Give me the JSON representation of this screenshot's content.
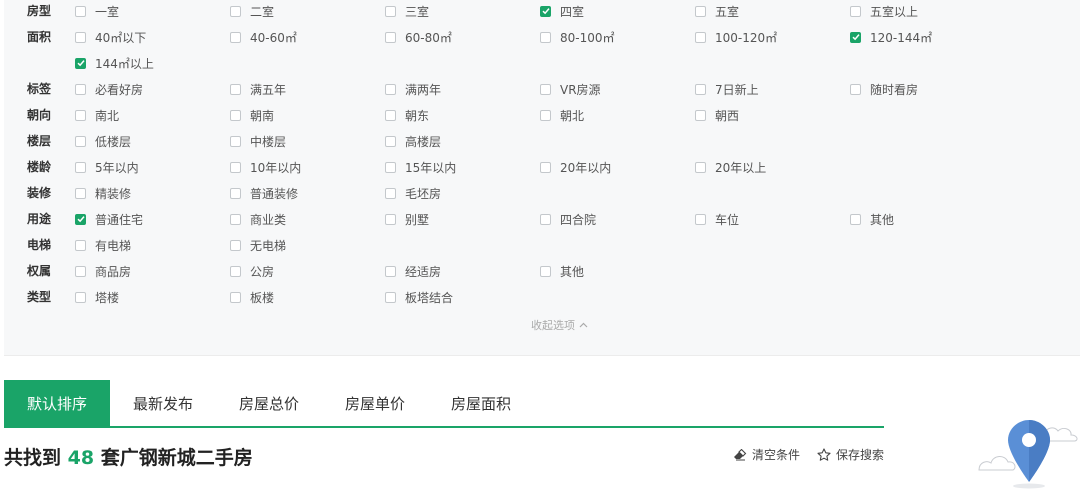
{
  "filters": [
    {
      "label": "房型",
      "options": [
        {
          "text": "一室",
          "checked": false
        },
        {
          "text": "二室",
          "checked": false
        },
        {
          "text": "三室",
          "checked": false
        },
        {
          "text": "四室",
          "checked": true
        },
        {
          "text": "五室",
          "checked": false
        },
        {
          "text": "五室以上",
          "checked": false
        }
      ]
    },
    {
      "label": "面积",
      "options": [
        {
          "text": "40㎡以下",
          "checked": false
        },
        {
          "text": "40-60㎡",
          "checked": false
        },
        {
          "text": "60-80㎡",
          "checked": false
        },
        {
          "text": "80-100㎡",
          "checked": false
        },
        {
          "text": "100-120㎡",
          "checked": false
        },
        {
          "text": "120-144㎡",
          "checked": true
        },
        {
          "text": "144㎡以上",
          "checked": true
        }
      ]
    },
    {
      "label": "标签",
      "options": [
        {
          "text": "必看好房",
          "checked": false
        },
        {
          "text": "满五年",
          "checked": false
        },
        {
          "text": "满两年",
          "checked": false
        },
        {
          "text": "VR房源",
          "checked": false
        },
        {
          "text": "7日新上",
          "checked": false
        },
        {
          "text": "随时看房",
          "checked": false
        }
      ]
    },
    {
      "label": "朝向",
      "options": [
        {
          "text": "南北",
          "checked": false
        },
        {
          "text": "朝南",
          "checked": false
        },
        {
          "text": "朝东",
          "checked": false
        },
        {
          "text": "朝北",
          "checked": false
        },
        {
          "text": "朝西",
          "checked": false
        }
      ]
    },
    {
      "label": "楼层",
      "options": [
        {
          "text": "低楼层",
          "checked": false
        },
        {
          "text": "中楼层",
          "checked": false
        },
        {
          "text": "高楼层",
          "checked": false
        }
      ]
    },
    {
      "label": "楼龄",
      "options": [
        {
          "text": "5年以内",
          "checked": false
        },
        {
          "text": "10年以内",
          "checked": false
        },
        {
          "text": "15年以内",
          "checked": false
        },
        {
          "text": "20年以内",
          "checked": false
        },
        {
          "text": "20年以上",
          "checked": false
        }
      ]
    },
    {
      "label": "装修",
      "options": [
        {
          "text": "精装修",
          "checked": false
        },
        {
          "text": "普通装修",
          "checked": false
        },
        {
          "text": "毛坯房",
          "checked": false
        }
      ]
    },
    {
      "label": "用途",
      "options": [
        {
          "text": "普通住宅",
          "checked": true
        },
        {
          "text": "商业类",
          "checked": false
        },
        {
          "text": "别墅",
          "checked": false
        },
        {
          "text": "四合院",
          "checked": false
        },
        {
          "text": "车位",
          "checked": false
        },
        {
          "text": "其他",
          "checked": false
        }
      ]
    },
    {
      "label": "电梯",
      "options": [
        {
          "text": "有电梯",
          "checked": false
        },
        {
          "text": "无电梯",
          "checked": false
        }
      ]
    },
    {
      "label": "权属",
      "options": [
        {
          "text": "商品房",
          "checked": false
        },
        {
          "text": "公房",
          "checked": false
        },
        {
          "text": "经适房",
          "checked": false
        },
        {
          "text": "其他",
          "checked": false
        }
      ]
    },
    {
      "label": "类型",
      "options": [
        {
          "text": "塔楼",
          "checked": false
        },
        {
          "text": "板楼",
          "checked": false
        },
        {
          "text": "板塔结合",
          "checked": false
        }
      ]
    }
  ],
  "collapse_label": "收起选项",
  "sort_tabs": [
    {
      "label": "默认排序",
      "active": true
    },
    {
      "label": "最新发布",
      "active": false
    },
    {
      "label": "房屋总价",
      "active": false
    },
    {
      "label": "房屋单价",
      "active": false
    },
    {
      "label": "房屋面积",
      "active": false
    }
  ],
  "result": {
    "prefix": "共找到",
    "count": "48",
    "suffix": "套广钢新城二手房"
  },
  "actions": {
    "clear_label": "清空条件",
    "save_label": "保存搜索"
  },
  "colors": {
    "accent": "#1aa468"
  }
}
